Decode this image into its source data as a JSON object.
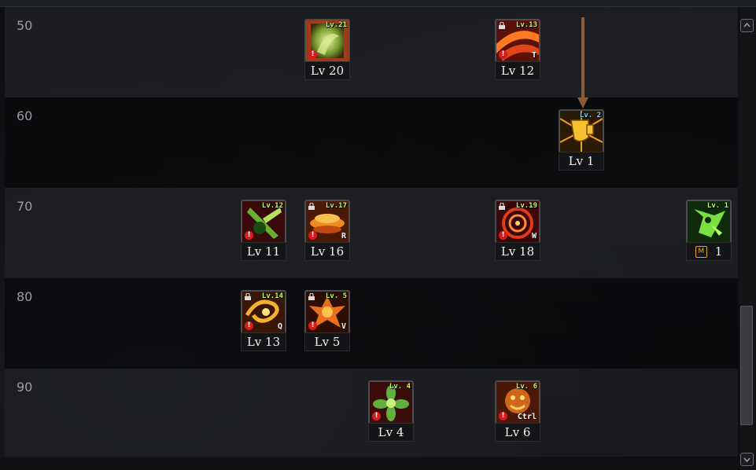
{
  "rows": [
    {
      "level": "50"
    },
    {
      "level": "60"
    },
    {
      "level": "70"
    },
    {
      "level": "80"
    },
    {
      "level": "90"
    }
  ],
  "skills": [
    {
      "id": "s50a",
      "tag": "Lv.21",
      "label": "Lv 20",
      "hotkey": "",
      "locked": false,
      "warn": true,
      "icon": "green-vortex-icon"
    },
    {
      "id": "s50b",
      "tag": "Lv.13",
      "label": "Lv 12",
      "hotkey": "T",
      "locked": true,
      "warn": true,
      "icon": "red-slash-icon"
    },
    {
      "id": "s60a",
      "tag": "Lv. 2",
      "label": "Lv 1",
      "hotkey": "",
      "locked": false,
      "warn": false,
      "icon": "golden-shield-icon"
    },
    {
      "id": "s70a",
      "tag": "Lv.12",
      "label": "Lv 11",
      "hotkey": "",
      "locked": false,
      "warn": true,
      "icon": "green-blade-icon"
    },
    {
      "id": "s70b",
      "tag": "Lv.17",
      "label": "Lv 16",
      "hotkey": "R",
      "locked": true,
      "warn": true,
      "icon": "orange-wave-icon"
    },
    {
      "id": "s70c",
      "tag": "Lv.19",
      "label": "Lv 18",
      "hotkey": "W",
      "locked": true,
      "warn": true,
      "icon": "red-spiral-icon"
    },
    {
      "id": "s70d",
      "tag": "Lv. 1",
      "label": "1",
      "hotkey": "",
      "locked": false,
      "warn": false,
      "icon": "green-beast-icon",
      "mastery": "M"
    },
    {
      "id": "s80a",
      "tag": "Lv.14",
      "label": "Lv 13",
      "hotkey": "Q",
      "locked": true,
      "warn": true,
      "icon": "orange-swirl-icon"
    },
    {
      "id": "s80b",
      "tag": "Lv. 5",
      "label": "Lv 5",
      "hotkey": "V",
      "locked": true,
      "warn": true,
      "icon": "orange-burst-icon"
    },
    {
      "id": "s90a",
      "tag": "Lv. 4",
      "label": "Lv 4",
      "hotkey": "",
      "locked": false,
      "warn": true,
      "icon": "green-flower-icon"
    },
    {
      "id": "s90b",
      "tag": "Lv. 6",
      "label": "Lv 6",
      "hotkey": "Ctrl",
      "locked": false,
      "warn": true,
      "icon": "orange-roar-icon"
    }
  ],
  "colors": {
    "tag_green": "#b8ff5a",
    "tag_blue": "#7fd0ff",
    "mastery_orange": "#f2b233",
    "arrow_brown": "#8a5a3a"
  }
}
